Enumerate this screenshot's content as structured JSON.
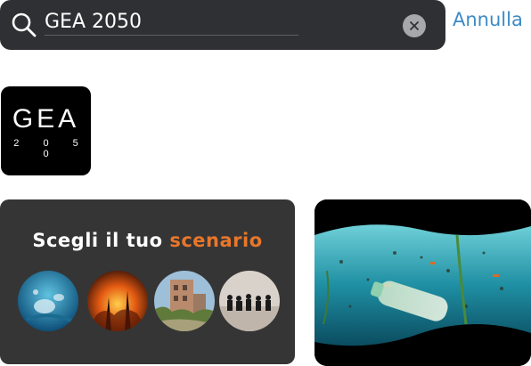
{
  "search": {
    "value": "GEA 2050",
    "cancel_label": "Annulla"
  },
  "app_logo": {
    "title": "GEA",
    "year": "2 0 5 0"
  },
  "scenario": {
    "title_prefix": "Scegli il tuo",
    "title_accent": "scenario",
    "accent_color": "#e8762b",
    "options": [
      "underwater-pollution-icon",
      "wildfire-icon",
      "ruined-city-icon",
      "refugees-icon"
    ]
  },
  "colors": {
    "search_bg": "#2f3033",
    "link": "#3d8ac5",
    "card_bg": "#353535"
  }
}
